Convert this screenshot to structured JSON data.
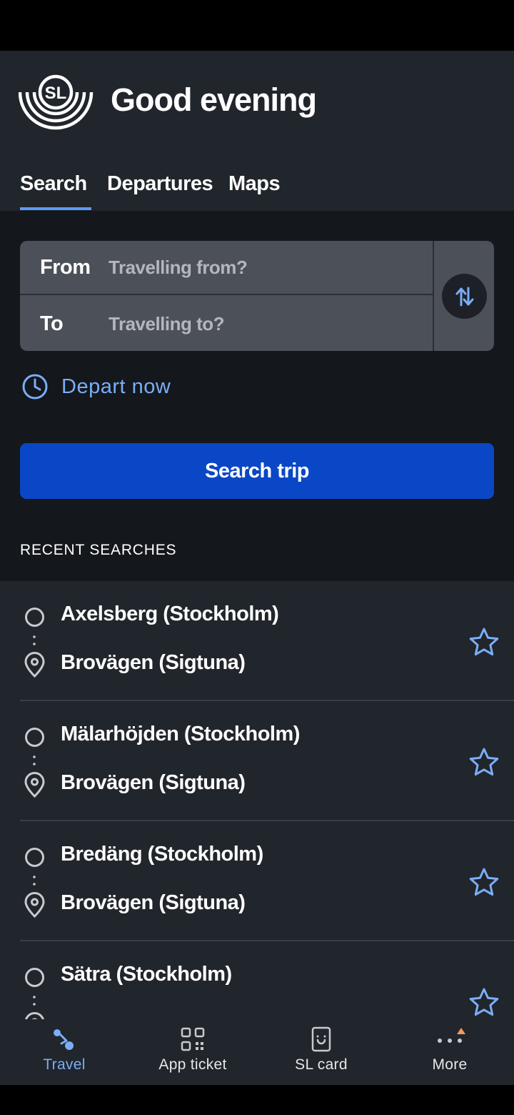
{
  "header": {
    "logo_text": "SL",
    "greeting": "Good evening",
    "tabs": [
      {
        "label": "Search",
        "active": true
      },
      {
        "label": "Departures",
        "active": false
      },
      {
        "label": "Maps",
        "active": false
      }
    ]
  },
  "trip_form": {
    "from_label": "From",
    "from_placeholder": "Travelling from?",
    "to_label": "To",
    "to_placeholder": "Travelling to?",
    "swap_icon": "swap-vertical-icon",
    "depart_label": "Depart now",
    "search_button": "Search trip"
  },
  "recent": {
    "heading": "RECENT SEARCHES",
    "items": [
      {
        "from": "Axelsberg (Stockholm)",
        "to": "Brovägen (Sigtuna)"
      },
      {
        "from": "Mälarhöjden (Stockholm)",
        "to": "Brovägen (Sigtuna)"
      },
      {
        "from": "Bredäng (Stockholm)",
        "to": "Brovägen (Sigtuna)"
      },
      {
        "from": "Sätra (Stockholm)",
        "to": ""
      }
    ]
  },
  "bottom_nav": {
    "items": [
      {
        "label": "Travel",
        "icon": "travel-route-icon",
        "active": true
      },
      {
        "label": "App ticket",
        "icon": "qr-code-icon",
        "active": false
      },
      {
        "label": "SL card",
        "icon": "sl-card-icon",
        "active": false
      },
      {
        "label": "More",
        "icon": "more-dots-icon",
        "active": false,
        "badge": true
      }
    ]
  },
  "colors": {
    "background": "#21252c",
    "main_background": "#14171c",
    "accent": "#7aaef7",
    "primary_button": "#0a47c6",
    "notification_badge": "#f29a5c"
  }
}
